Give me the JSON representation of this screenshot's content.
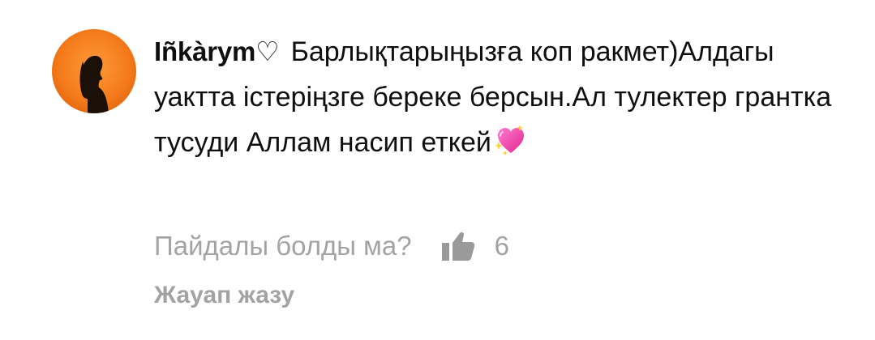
{
  "comment": {
    "author": "Iñkàrym♡",
    "text": "Барлықтарыңызға коп ракмет)Алдагы уактта істеріңзге береке берсын.Ал тулектер грантка тусуди Аллам насип еткей",
    "emoji": "sparkling-heart-icon"
  },
  "actions": {
    "helpful_prompt": "Пайдалы болды ма?",
    "like_icon": "thumbs-up-icon",
    "like_count": "6",
    "reply_label": "Жауап жазу"
  },
  "colors": {
    "avatar_bg": "#f47a1a",
    "secondary_text": "#a3a3a3",
    "primary_text": "#0f0f0f"
  }
}
